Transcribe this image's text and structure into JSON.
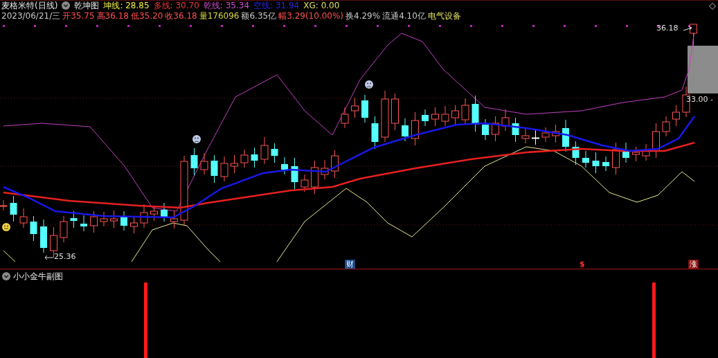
{
  "stock_header": {
    "title": "麦格米特(日线)",
    "indicator_name": "乾坤图",
    "indicator_values": [
      {
        "label": "坤线: 28.85",
        "color": "#f2f24a"
      },
      {
        "label": "多线: 30.70",
        "color": "#e83a3a"
      },
      {
        "label": "乾线: 35.34",
        "color": "#d050d0"
      },
      {
        "label": "空线: 31.94",
        "color": "#2828e0"
      },
      {
        "label": "XG: 0.00",
        "color": "#e0e060"
      }
    ]
  },
  "quote_row": [
    {
      "text": "2023/06/21/三",
      "color": "#c8c8c8"
    },
    {
      "text": "开35.75",
      "color": "#ff5050"
    },
    {
      "text": "高36.18",
      "color": "#ff5050"
    },
    {
      "text": "低35.20",
      "color": "#ff5050"
    },
    {
      "text": "收36.18",
      "color": "#ff5050"
    },
    {
      "text": "量176096",
      "color": "#d8d840"
    },
    {
      "text": "额6.35亿",
      "color": "#c8c8c8"
    },
    {
      "text": "幅3.29(10.00%)",
      "color": "#ff5050"
    },
    {
      "text": "换4.29%",
      "color": "#c8c8c8"
    },
    {
      "text": "流通4.10亿",
      "color": "#c8c8c8"
    },
    {
      "text": "电气设备",
      "color": "#e0e060"
    }
  ],
  "price_labels": [
    {
      "text": "36.18",
      "kind": "high"
    },
    {
      "text": "33.00 -",
      "kind": "level"
    },
    {
      "text": "25.36",
      "kind": "low"
    }
  ],
  "event_markers": [
    {
      "text": "财",
      "kind": "finance"
    },
    {
      "text": "$",
      "kind": "dividend"
    },
    {
      "text": "涨",
      "kind": "limit_up"
    }
  ],
  "sub_chart": {
    "title": "小小金牛副图"
  }
}
